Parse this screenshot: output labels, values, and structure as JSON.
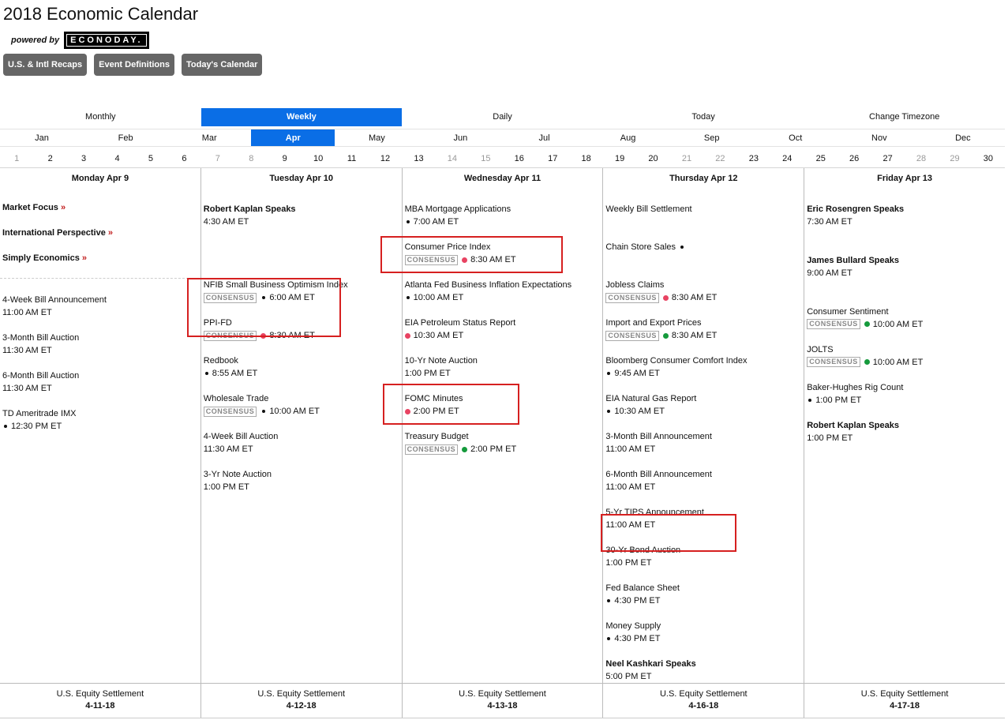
{
  "page": {
    "title": "2018 Economic Calendar",
    "powered_by": "powered by",
    "logo_text": "ECONODAY."
  },
  "nav_buttons": [
    "U.S. & Intl Recaps",
    "Event Definitions",
    "Today's Calendar"
  ],
  "view_tabs": [
    {
      "label": "Monthly",
      "active": false
    },
    {
      "label": "Weekly",
      "active": true
    },
    {
      "label": "Daily",
      "active": false
    },
    {
      "label": "Today",
      "active": false
    },
    {
      "label": "Change Timezone",
      "active": false
    }
  ],
  "months": [
    {
      "label": "Jan",
      "active": false
    },
    {
      "label": "Feb",
      "active": false
    },
    {
      "label": "Mar",
      "active": false
    },
    {
      "label": "Apr",
      "active": true
    },
    {
      "label": "May",
      "active": false
    },
    {
      "label": "Jun",
      "active": false
    },
    {
      "label": "Jul",
      "active": false
    },
    {
      "label": "Aug",
      "active": false
    },
    {
      "label": "Sep",
      "active": false
    },
    {
      "label": "Oct",
      "active": false
    },
    {
      "label": "Nov",
      "active": false
    },
    {
      "label": "Dec",
      "active": false
    }
  ],
  "day_numbers": [
    {
      "n": "1",
      "weekend": true
    },
    {
      "n": "2",
      "weekend": false
    },
    {
      "n": "3",
      "weekend": false
    },
    {
      "n": "4",
      "weekend": false
    },
    {
      "n": "5",
      "weekend": false
    },
    {
      "n": "6",
      "weekend": false
    },
    {
      "n": "7",
      "weekend": true
    },
    {
      "n": "8",
      "weekend": true
    },
    {
      "n": "9",
      "weekend": false
    },
    {
      "n": "10",
      "weekend": false
    },
    {
      "n": "11",
      "weekend": false
    },
    {
      "n": "12",
      "weekend": false
    },
    {
      "n": "13",
      "weekend": false
    },
    {
      "n": "14",
      "weekend": true
    },
    {
      "n": "15",
      "weekend": true
    },
    {
      "n": "16",
      "weekend": false
    },
    {
      "n": "17",
      "weekend": false
    },
    {
      "n": "18",
      "weekend": false
    },
    {
      "n": "19",
      "weekend": false
    },
    {
      "n": "20",
      "weekend": false
    },
    {
      "n": "21",
      "weekend": true
    },
    {
      "n": "22",
      "weekend": true
    },
    {
      "n": "23",
      "weekend": false
    },
    {
      "n": "24",
      "weekend": false
    },
    {
      "n": "25",
      "weekend": false
    },
    {
      "n": "26",
      "weekend": false
    },
    {
      "n": "27",
      "weekend": false
    },
    {
      "n": "28",
      "weekend": true
    },
    {
      "n": "29",
      "weekend": true
    },
    {
      "n": "30",
      "weekend": false
    }
  ],
  "colors": {
    "accent": "#0a6ee6",
    "dot_red": "#e84362",
    "dot_green": "#159a3c",
    "highlight": "#d62020"
  },
  "days": [
    {
      "header": "Monday Apr 9",
      "focus_links": [
        {
          "label": "Market Focus",
          "arrow": "»"
        },
        {
          "label": "International Perspective",
          "arrow": "»"
        },
        {
          "label": "Simply Economics",
          "arrow": "»"
        }
      ],
      "events": [
        {
          "title": "4-Week Bill Announcement",
          "time": "11:00 AM ET",
          "slot": 3
        },
        {
          "title": "3-Month Bill Auction",
          "time": "11:30 AM ET",
          "slot": 4
        },
        {
          "title": "6-Month Bill Auction",
          "time": "11:30 AM ET",
          "slot": 5
        },
        {
          "title": "TD Ameritrade IMX",
          "time": "12:30 PM ET",
          "dot": "black",
          "slot": 6
        }
      ],
      "footer": {
        "label": "U.S. Equity Settlement",
        "date": "4-11-18"
      }
    },
    {
      "header": "Tuesday Apr 10",
      "events": [
        {
          "title": "Robert Kaplan Speaks",
          "bold": true,
          "time": "4:30 AM ET",
          "slot": 0
        },
        {
          "title": "NFIB Small Business Optimism Index",
          "consensus": "CONSENSUS",
          "dot": "black",
          "time": "6:00 AM ET",
          "slot": 2
        },
        {
          "title": "PPI-FD",
          "consensus": "CONSENSUS",
          "dot": "red",
          "time": "8:30 AM ET",
          "slot": 3
        },
        {
          "title": "Redbook",
          "dot": "black",
          "time": "8:55 AM ET",
          "slot": 4
        },
        {
          "title": "Wholesale Trade",
          "consensus": "CONSENSUS",
          "dot": "black",
          "time": "10:00 AM ET",
          "slot": 5
        },
        {
          "title": "4-Week Bill Auction",
          "time": "11:30 AM ET",
          "slot": 6
        },
        {
          "title": "3-Yr Note Auction",
          "time": "1:00 PM ET",
          "slot": 7
        }
      ],
      "footer": {
        "label": "U.S. Equity Settlement",
        "date": "4-12-18"
      }
    },
    {
      "header": "Wednesday Apr 11",
      "events": [
        {
          "title": "MBA Mortgage Applications",
          "dot": "black",
          "time": "7:00 AM ET",
          "slot": 0
        },
        {
          "title": "Consumer Price Index",
          "consensus": "CONSENSUS",
          "dot": "red",
          "time": "8:30 AM ET",
          "slot": 1
        },
        {
          "title": "Atlanta Fed Business Inflation Expectations",
          "dot": "black",
          "time": "10:00 AM ET",
          "slot": 2
        },
        {
          "title": "EIA Petroleum Status Report",
          "dot": "red",
          "time": "10:30 AM ET",
          "slot": 3
        },
        {
          "title": "10-Yr Note Auction",
          "time": "1:00 PM ET",
          "slot": 4
        },
        {
          "title": "FOMC Minutes",
          "dot": "red",
          "time": "2:00 PM ET",
          "slot": 5
        },
        {
          "title": "Treasury Budget",
          "consensus": "CONSENSUS",
          "dot": "green",
          "time": "2:00 PM ET",
          "slot": 6
        }
      ],
      "footer": {
        "label": "U.S. Equity Settlement",
        "date": "4-13-18"
      }
    },
    {
      "header": "Thursday Apr 12",
      "events": [
        {
          "title": "Weekly Bill Settlement",
          "slot": 0
        },
        {
          "title": "Chain Store Sales",
          "trailing_dot": true,
          "slot": 1
        },
        {
          "title": "Jobless Claims",
          "consensus": "CONSENSUS",
          "dot": "red",
          "time": "8:30 AM ET",
          "slot": 2
        },
        {
          "title": "Import and Export Prices",
          "consensus": "CONSENSUS",
          "dot": "green",
          "time": "8:30 AM ET",
          "slot": 3
        },
        {
          "title": "Bloomberg Consumer Comfort Index",
          "dot": "black",
          "time": "9:45 AM ET",
          "slot": 4
        },
        {
          "title": "EIA Natural Gas Report",
          "dot": "black",
          "time": "10:30 AM ET",
          "slot": 5
        },
        {
          "title": "3-Month Bill Announcement",
          "time": "11:00 AM ET",
          "slot": 6
        },
        {
          "title": "6-Month Bill Announcement",
          "time": "11:00 AM ET",
          "slot": 7
        },
        {
          "title": "5-Yr TIPS Announcement",
          "time": "11:00 AM ET",
          "slot": 8
        },
        {
          "title": "30-Yr Bond Auction",
          "time": "1:00 PM ET",
          "slot": 9
        },
        {
          "title": "Fed Balance Sheet",
          "dot": "black",
          "time": "4:30 PM ET",
          "slot": 10
        },
        {
          "title": "Money Supply",
          "dot": "black",
          "time": "4:30 PM ET",
          "slot": 11
        },
        {
          "title": "Neel Kashkari Speaks",
          "bold": true,
          "time": "5:00 PM ET",
          "slot": 12
        }
      ],
      "footer": {
        "label": "U.S. Equity Settlement",
        "date": "4-16-18"
      }
    },
    {
      "header": "Friday Apr 13",
      "events": [
        {
          "title": "Eric Rosengren Speaks",
          "bold": true,
          "time": "7:30 AM ET",
          "slot": 0
        },
        {
          "title": "James Bullard Speaks",
          "bold": true,
          "time": "9:00 AM ET",
          "slot": 1.35
        },
        {
          "title": "Consumer Sentiment",
          "consensus": "CONSENSUS",
          "dot": "green",
          "time": "10:00 AM ET",
          "slot": 2.7
        },
        {
          "title": "JOLTS",
          "consensus": "CONSENSUS",
          "dot": "green",
          "time": "10:00 AM ET",
          "slot": 3.7
        },
        {
          "title": "Baker-Hughes Rig Count",
          "dot": "black",
          "time": "1:00 PM ET",
          "slot": 4.7
        },
        {
          "title": "Robert Kaplan Speaks",
          "bold": true,
          "time": "1:00 PM ET",
          "slot": 5.7
        }
      ],
      "footer": {
        "label": "U.S. Equity Settlement",
        "date": "4-17-18"
      }
    }
  ]
}
